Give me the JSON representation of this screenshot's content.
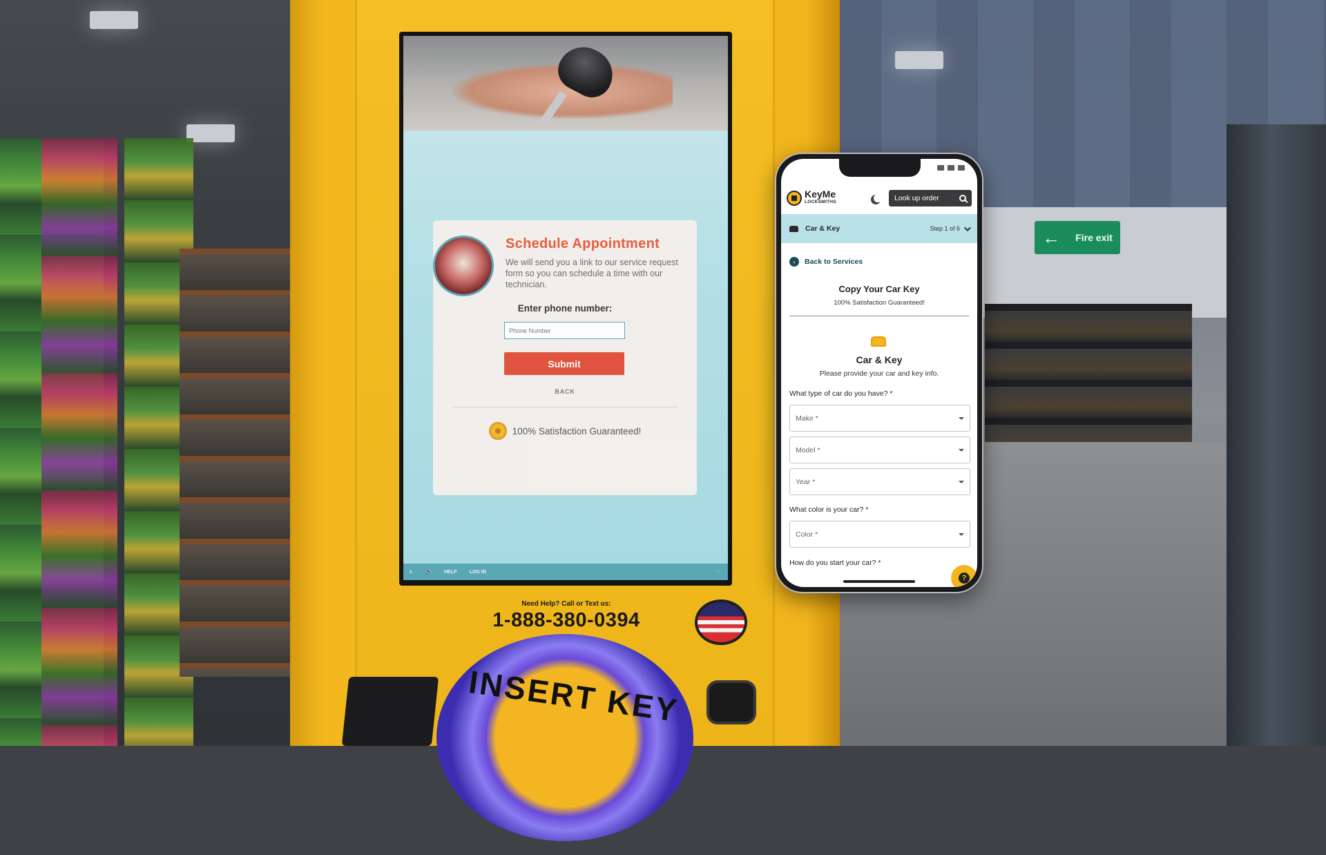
{
  "kiosk": {
    "title": "Schedule Appointment",
    "description": "We will send you a link to our service request form so you can schedule a time with our technician.",
    "phone_label": "Enter phone number:",
    "phone_placeholder": "Phone Number",
    "submit_label": "Submit",
    "back_label": "BACK",
    "guarantee": "100% Satisfaction Guaranteed!",
    "toolbar": {
      "help": "HELP",
      "login": "LOG IN"
    },
    "help_line": "Need Help? Call or Text us:",
    "phone_number": "1-888-380-0394",
    "insert_key_label": "INSERT KEY"
  },
  "store": {
    "exit_sign": "Fire exit"
  },
  "phone": {
    "brand": "KeyMe",
    "brand_sub": "LOCKSMITHS",
    "lookup_label": "Look up order",
    "step_title": "Car & Key",
    "step_count": "Step 1 of 6",
    "back_link": "Back to Services",
    "page_title": "Copy Your Car Key",
    "page_subtitle": "100% Satisfaction Guaranteed!",
    "section_title": "Car & Key",
    "section_subtitle": "Please provide your car and key info.",
    "q_car_type": "What type of car do you have? *",
    "make_placeholder": "Make *",
    "model_placeholder": "Model *",
    "year_placeholder": "Year *",
    "q_color": "What color is your car? *",
    "color_placeholder": "Color *",
    "q_start": "How do you start your car? *",
    "help_icon": "?"
  },
  "colors": {
    "kiosk_yellow": "#f4bd22",
    "accent_red": "#e2503a",
    "teal": "#5aa7b5",
    "step_bar": "#b8e1e8"
  }
}
